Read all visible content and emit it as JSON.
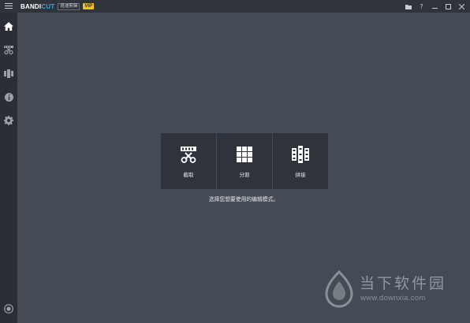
{
  "app": {
    "brand_prefix": "BANDI",
    "brand_suffix": "CUT",
    "brand_sub": "班迪剪辑",
    "vip_badge": "VIP"
  },
  "window_controls": {
    "folder": "folder-icon",
    "help": "?",
    "minimize": "—",
    "maximize": "☐",
    "close": "✕"
  },
  "sidebar": {
    "items": [
      {
        "icon": "home-icon",
        "active": true
      },
      {
        "icon": "cut-tool-icon",
        "active": false
      },
      {
        "icon": "film-join-icon",
        "active": false
      },
      {
        "icon": "info-icon",
        "active": false
      },
      {
        "icon": "gear-icon",
        "active": false
      }
    ],
    "bottom_icon": "record-icon"
  },
  "modes": [
    {
      "label": "截取",
      "icon": "trim-scissors-icon"
    },
    {
      "label": "分割",
      "icon": "split-grid-icon"
    },
    {
      "label": "拼接",
      "icon": "join-film-icon"
    }
  ],
  "hint": "选择您想要使用的编辑模式。",
  "watermark": {
    "title": "当下软件园",
    "url": "www.downxia.com"
  },
  "colors": {
    "background": "#454b55",
    "sidebar": "#2b2f35",
    "titlebar": "#2f333a",
    "mode_button": "#2f343c",
    "brand_accent": "#39a5e8",
    "vip": "#f4c21b"
  }
}
